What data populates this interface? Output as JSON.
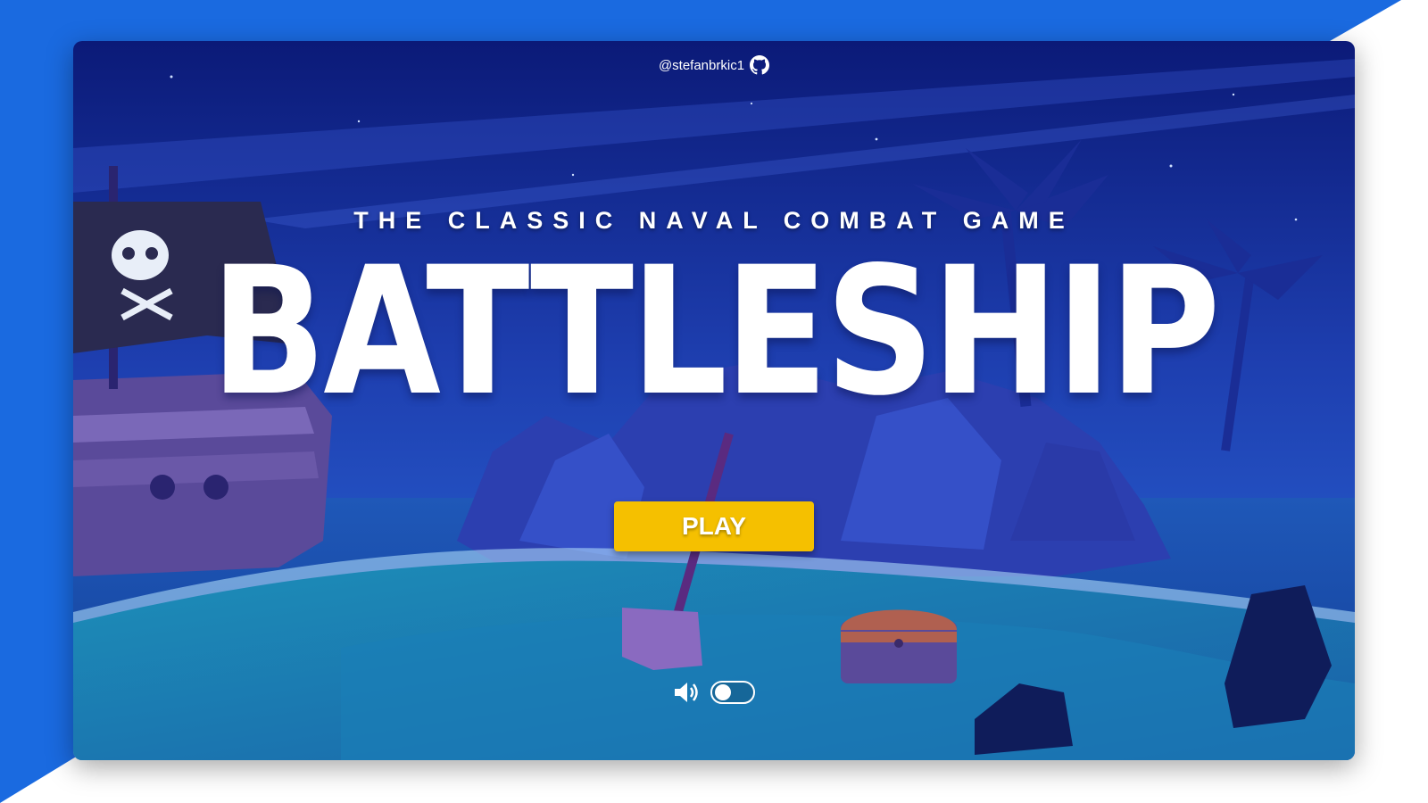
{
  "header": {
    "credit_handle": "@stefanbrkic1",
    "credit_icon": "github-icon"
  },
  "hero": {
    "subtitle": "THE CLASSIC NAVAL COMBAT GAME",
    "title": "BATTLESHIP"
  },
  "actions": {
    "play_label": "PLAY"
  },
  "sound": {
    "icon": "speaker-icon",
    "enabled": false
  },
  "colors": {
    "accent": "#f5c000",
    "background": "#1a6ae0",
    "night_sky": "#0c1a78"
  }
}
